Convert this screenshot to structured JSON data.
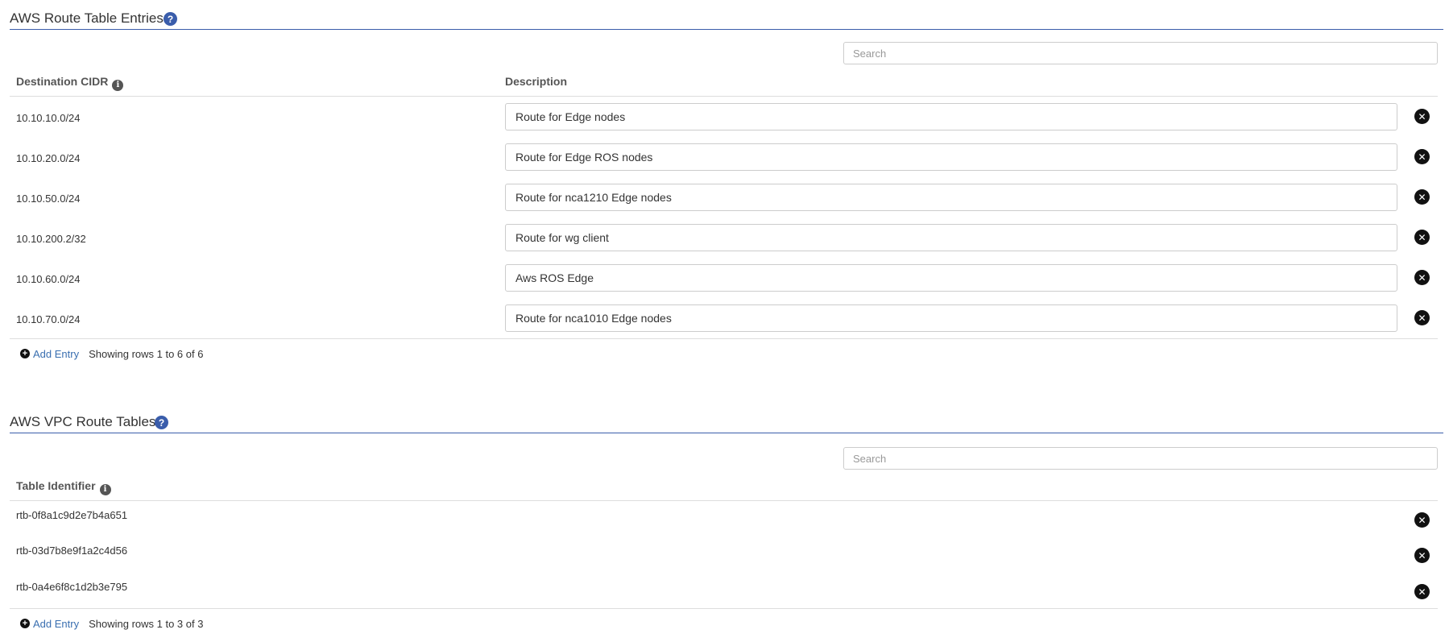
{
  "route_entries": {
    "title": "AWS Route Table Entries",
    "search_placeholder": "Search",
    "columns": {
      "cidr": "Destination CIDR",
      "description": "Description"
    },
    "rows": [
      {
        "cidr": "10.10.10.0/24",
        "description": "Route for Edge nodes"
      },
      {
        "cidr": "10.10.20.0/24",
        "description": "Route for Edge ROS nodes"
      },
      {
        "cidr": "10.10.50.0/24",
        "description": "Route for nca1210 Edge nodes"
      },
      {
        "cidr": "10.10.200.2/32",
        "description": "Route for wg client"
      },
      {
        "cidr": "10.10.60.0/24",
        "description": "Aws ROS Edge"
      },
      {
        "cidr": "10.10.70.0/24",
        "description": "Route for nca1010 Edge nodes"
      }
    ],
    "add_entry": "Add Entry",
    "showing": "Showing rows 1 to 6 of 6"
  },
  "vpc_tables": {
    "title": "AWS VPC Route Tables",
    "search_placeholder": "Search",
    "columns": {
      "identifier": "Table Identifier"
    },
    "rows": [
      {
        "identifier": "rtb-0f8a1c9d2e7b4a651"
      },
      {
        "identifier": "rtb-03d7b8e9f1a2c4d56"
      },
      {
        "identifier": "rtb-0a4e6f8c1d2b3e795"
      }
    ],
    "add_entry": "Add Entry",
    "showing": "Showing rows 1 to 3 of 3"
  },
  "icons": {
    "help": "question-circle-icon",
    "info": "info-circle-icon",
    "delete": "times-circle-icon",
    "add": "plus-circle-icon"
  },
  "colors": {
    "accent": "#3a5dab",
    "link": "#3a6fb0"
  }
}
